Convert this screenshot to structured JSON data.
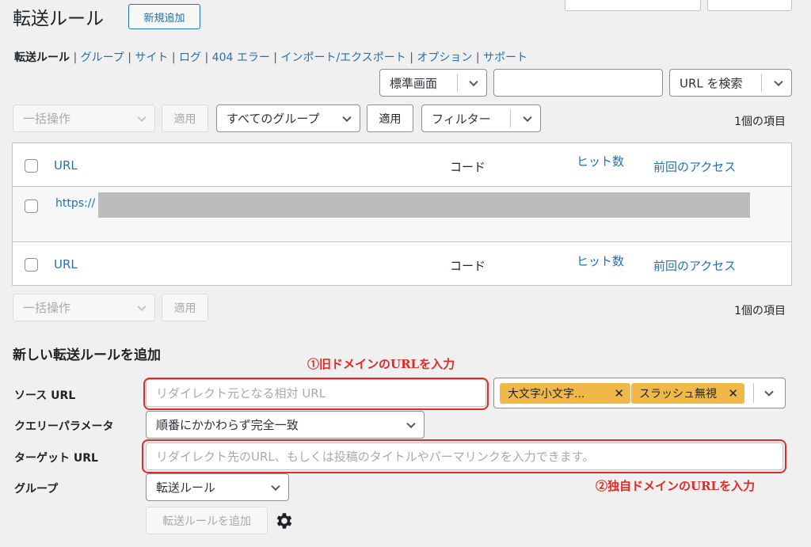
{
  "header": {
    "title": "転送ルール",
    "add_new_label": "新規追加"
  },
  "subnav": [
    {
      "label": "転送ルール",
      "current": true
    },
    {
      "label": "グループ"
    },
    {
      "label": "サイト"
    },
    {
      "label": "ログ"
    },
    {
      "label": "404 エラー"
    },
    {
      "label": "インポート/エクスポート"
    },
    {
      "label": "オプション"
    },
    {
      "label": "サポート"
    }
  ],
  "search": {
    "view_mode": "標準画面",
    "query": "",
    "search_by": "URL を検索"
  },
  "tablenav_top": {
    "bulk_action": "一括操作",
    "apply_label": "適用",
    "group_filter": "すべてのグループ",
    "apply2_label": "適用",
    "filter_label": "フィルター",
    "count": "1個の項目"
  },
  "table": {
    "columns": {
      "url": "URL",
      "code": "コード",
      "hits": "ヒット数",
      "last_access": "前回のアクセス"
    },
    "rows": [
      {
        "url": "https://"
      }
    ]
  },
  "tablenav_bottom": {
    "bulk_action": "一括操作",
    "apply_label": "適用",
    "count": "1個の項目"
  },
  "form": {
    "heading": "新しい転送ルールを追加",
    "source_label": "ソース URL",
    "source_placeholder": "リダイレクト元となる相対 URL",
    "flags": [
      "大文字小文字...",
      "スラッシュ無視"
    ],
    "query_label": "クエリーパラメータ",
    "query_value": "順番にかかわらず完全一致",
    "target_label": "ターゲット URL",
    "target_placeholder": "リダイレクト先のURL、もしくは投稿のタイトルやパーマリンクを入力できます。",
    "group_label": "グループ",
    "group_value": "転送ルール",
    "submit_label": "転送ルールを追加"
  },
  "annotations": {
    "note1": "①旧ドメインのURLを入力",
    "note2": "②独自ドメインのURLを入力"
  },
  "colors": {
    "accent": "#2271b1",
    "highlight_red": "#e02b27",
    "tag_yellow": "#f0b849"
  }
}
